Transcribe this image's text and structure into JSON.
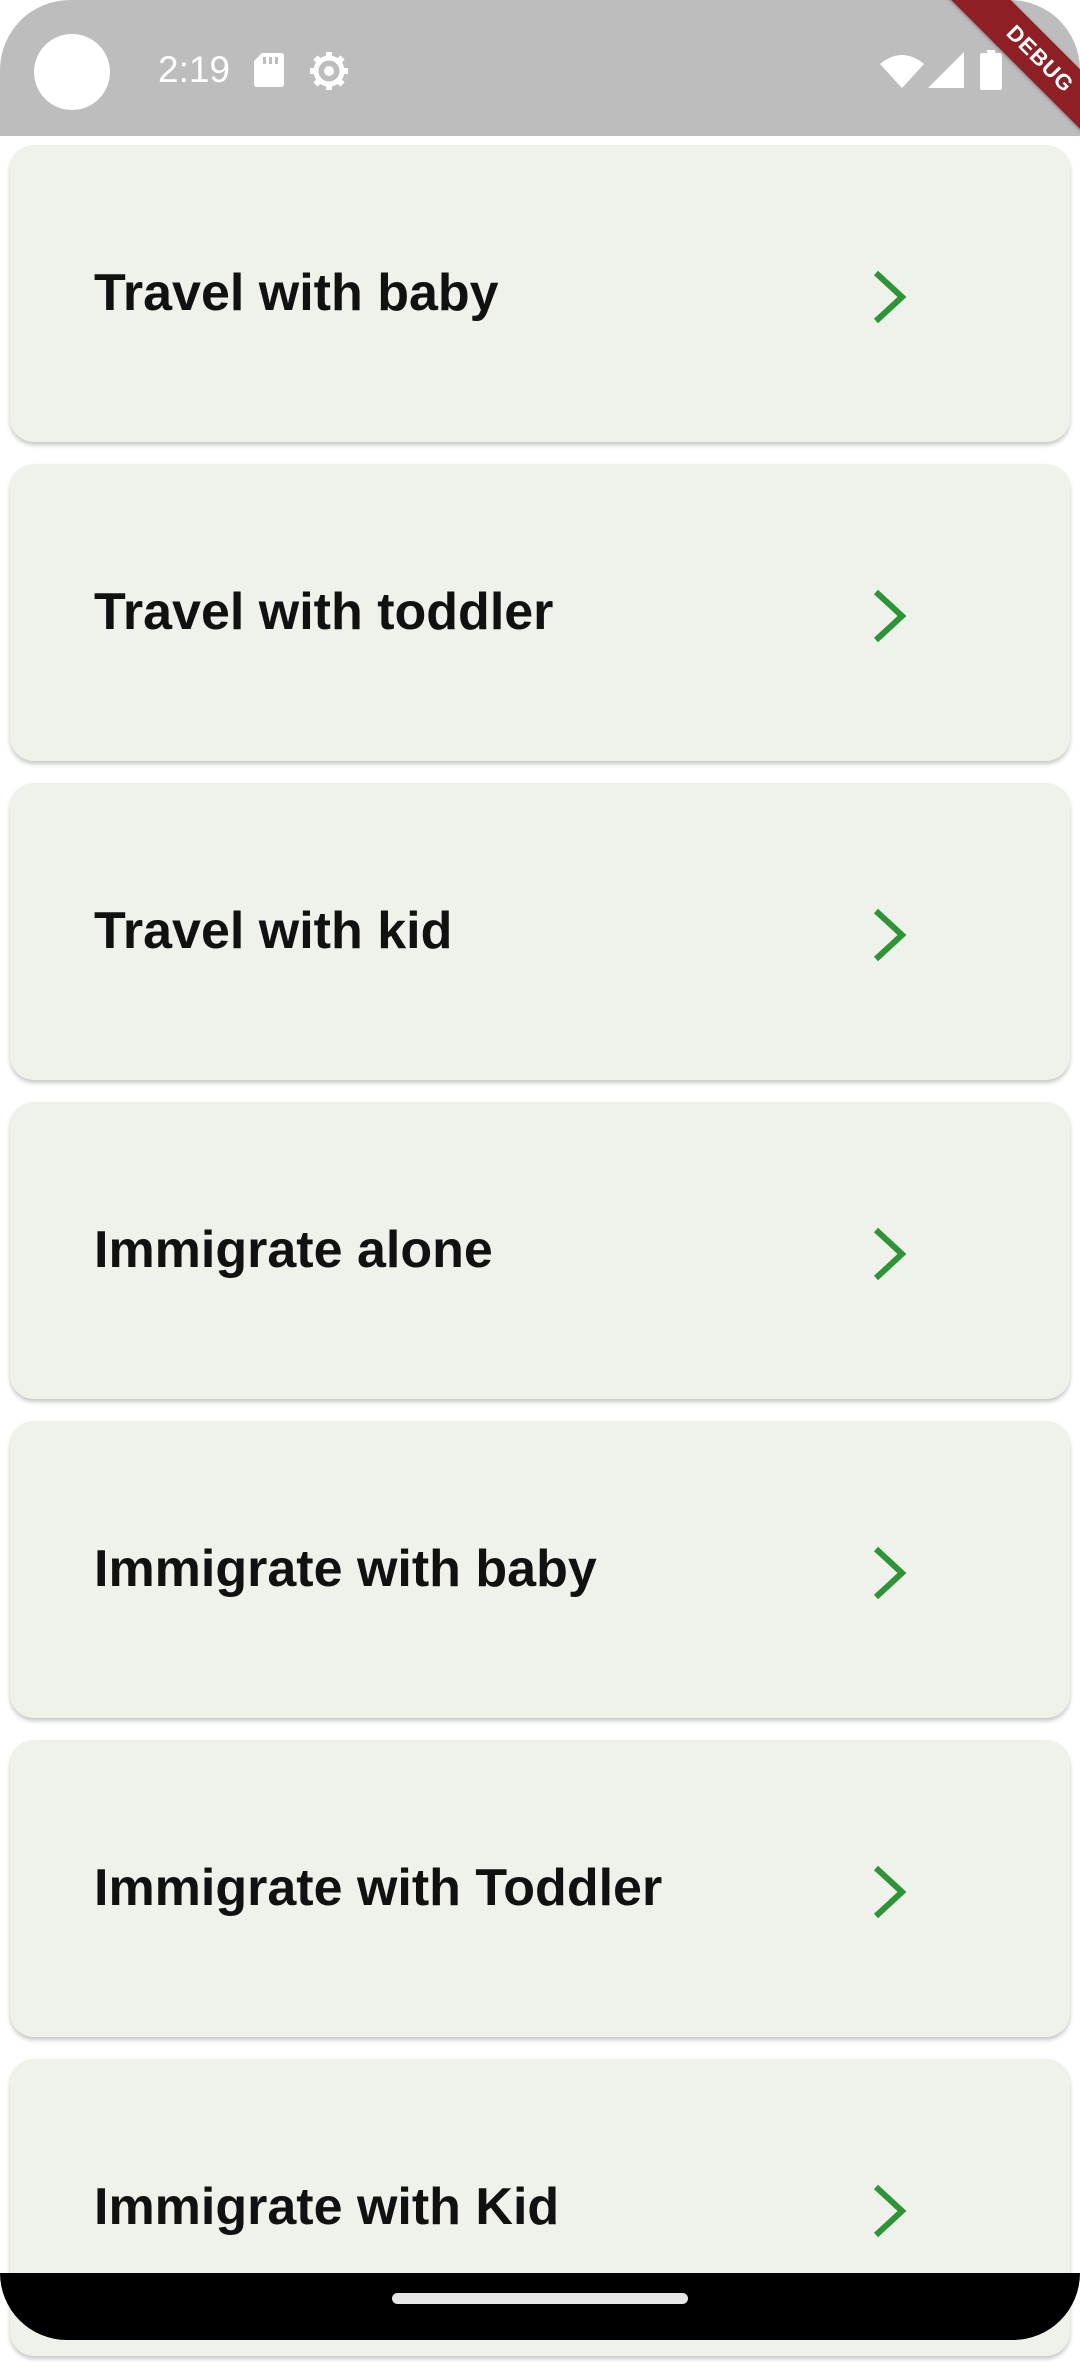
{
  "status_bar": {
    "time": "2:19",
    "icons": [
      "sd-card-icon",
      "settings-gear-icon",
      "wifi-icon",
      "signal-icon",
      "battery-icon"
    ]
  },
  "debug_banner": "DEBUG",
  "colors": {
    "card_background": "#eff2ea",
    "chevron": "#2e9437",
    "label_text": "#111111",
    "status_bar": "#bdbdbd",
    "debug_ribbon": "#8e1f24"
  },
  "menu_items": [
    {
      "label": "Travel with baby"
    },
    {
      "label": "Travel with toddler"
    },
    {
      "label": "Travel with kid"
    },
    {
      "label": "Immigrate alone"
    },
    {
      "label": "Immigrate with baby"
    },
    {
      "label": "Immigrate with Toddler"
    },
    {
      "label": "Immigrate with Kid"
    }
  ]
}
